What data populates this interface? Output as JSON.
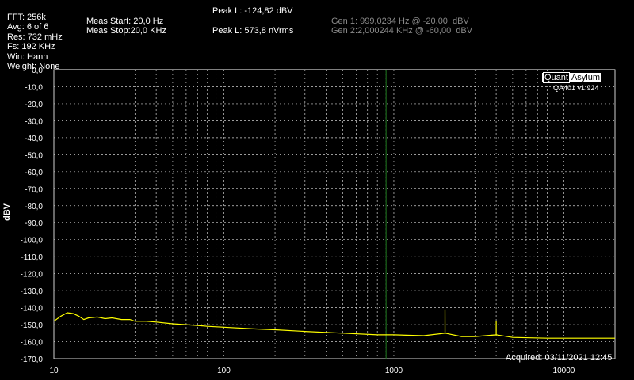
{
  "header": {
    "fft": "FFT: 256k",
    "avg": "Avg: 6 of 6",
    "res": "Res: 732 mHz",
    "fs": "Fs: 192 KHz",
    "win": "Win: Hann",
    "weight": "Weight: None",
    "meas_start": "Meas Start: 20,0 Hz",
    "meas_stop": "Meas Stop:20,0 KHz",
    "peak_dbv": "Peak L: -124,82 dBV",
    "peak_nvrms": "Peak L: 573,8 nVrms",
    "gen1": "Gen 1: 999,0234 Hz @ -20,00  dBV",
    "gen2": "Gen 2:2,000244 KHz @ -60,00  dBV"
  },
  "logo": {
    "quant": "Quant",
    "asylum": "Asylum",
    "version": "QA401 v1.924"
  },
  "acquired": "Acquired: 03/11/2021  12:45",
  "colors": {
    "trace": "#ffff00",
    "grid": "#d0d0d0",
    "marker": "#1f7a1f",
    "background": "#000000"
  },
  "chart_data": {
    "type": "line",
    "ylabel": "dBV",
    "xlabel": "",
    "x_scale": "log",
    "xlim": [
      10,
      20000
    ],
    "ylim": [
      -170,
      0
    ],
    "x_ticks": [
      "10",
      "100",
      "1000",
      "10000"
    ],
    "y_ticks": [
      "0,0",
      "-10,0",
      "-20,0",
      "-30,0",
      "-40,0",
      "-50,0",
      "-60,0",
      "-70,0",
      "-80,0",
      "-90,0",
      "-100,0",
      "-110,0",
      "-120,0",
      "-130,0",
      "-140,0",
      "-150,0",
      "-160,0",
      "-170,0"
    ],
    "grid": true,
    "reference_line_dbv": 0,
    "marker_frequency_hz": 900,
    "series": [
      {
        "x": [
          10,
          11,
          12,
          13,
          14,
          15,
          16,
          18,
          20,
          22,
          25,
          28,
          30,
          35,
          40,
          50,
          60,
          70,
          80,
          100,
          150,
          200,
          300,
          500,
          800,
          1000,
          1500,
          1999,
          2000,
          2001,
          2500,
          3000,
          3999,
          4000,
          4001,
          5000,
          8000,
          10000,
          15000,
          20000
        ],
        "y": [
          -148,
          -145,
          -143,
          -143.5,
          -145,
          -147,
          -146,
          -145.5,
          -146.5,
          -146,
          -147,
          -147,
          -148,
          -148,
          -148.5,
          -149.5,
          -150,
          -150.5,
          -151,
          -151.5,
          -152.5,
          -153,
          -154,
          -155,
          -156,
          -156,
          -156.5,
          -155,
          -141,
          -155,
          -157,
          -157,
          -156,
          -148,
          -156,
          -157.5,
          -158,
          -158,
          -158,
          -158
        ]
      }
    ]
  }
}
